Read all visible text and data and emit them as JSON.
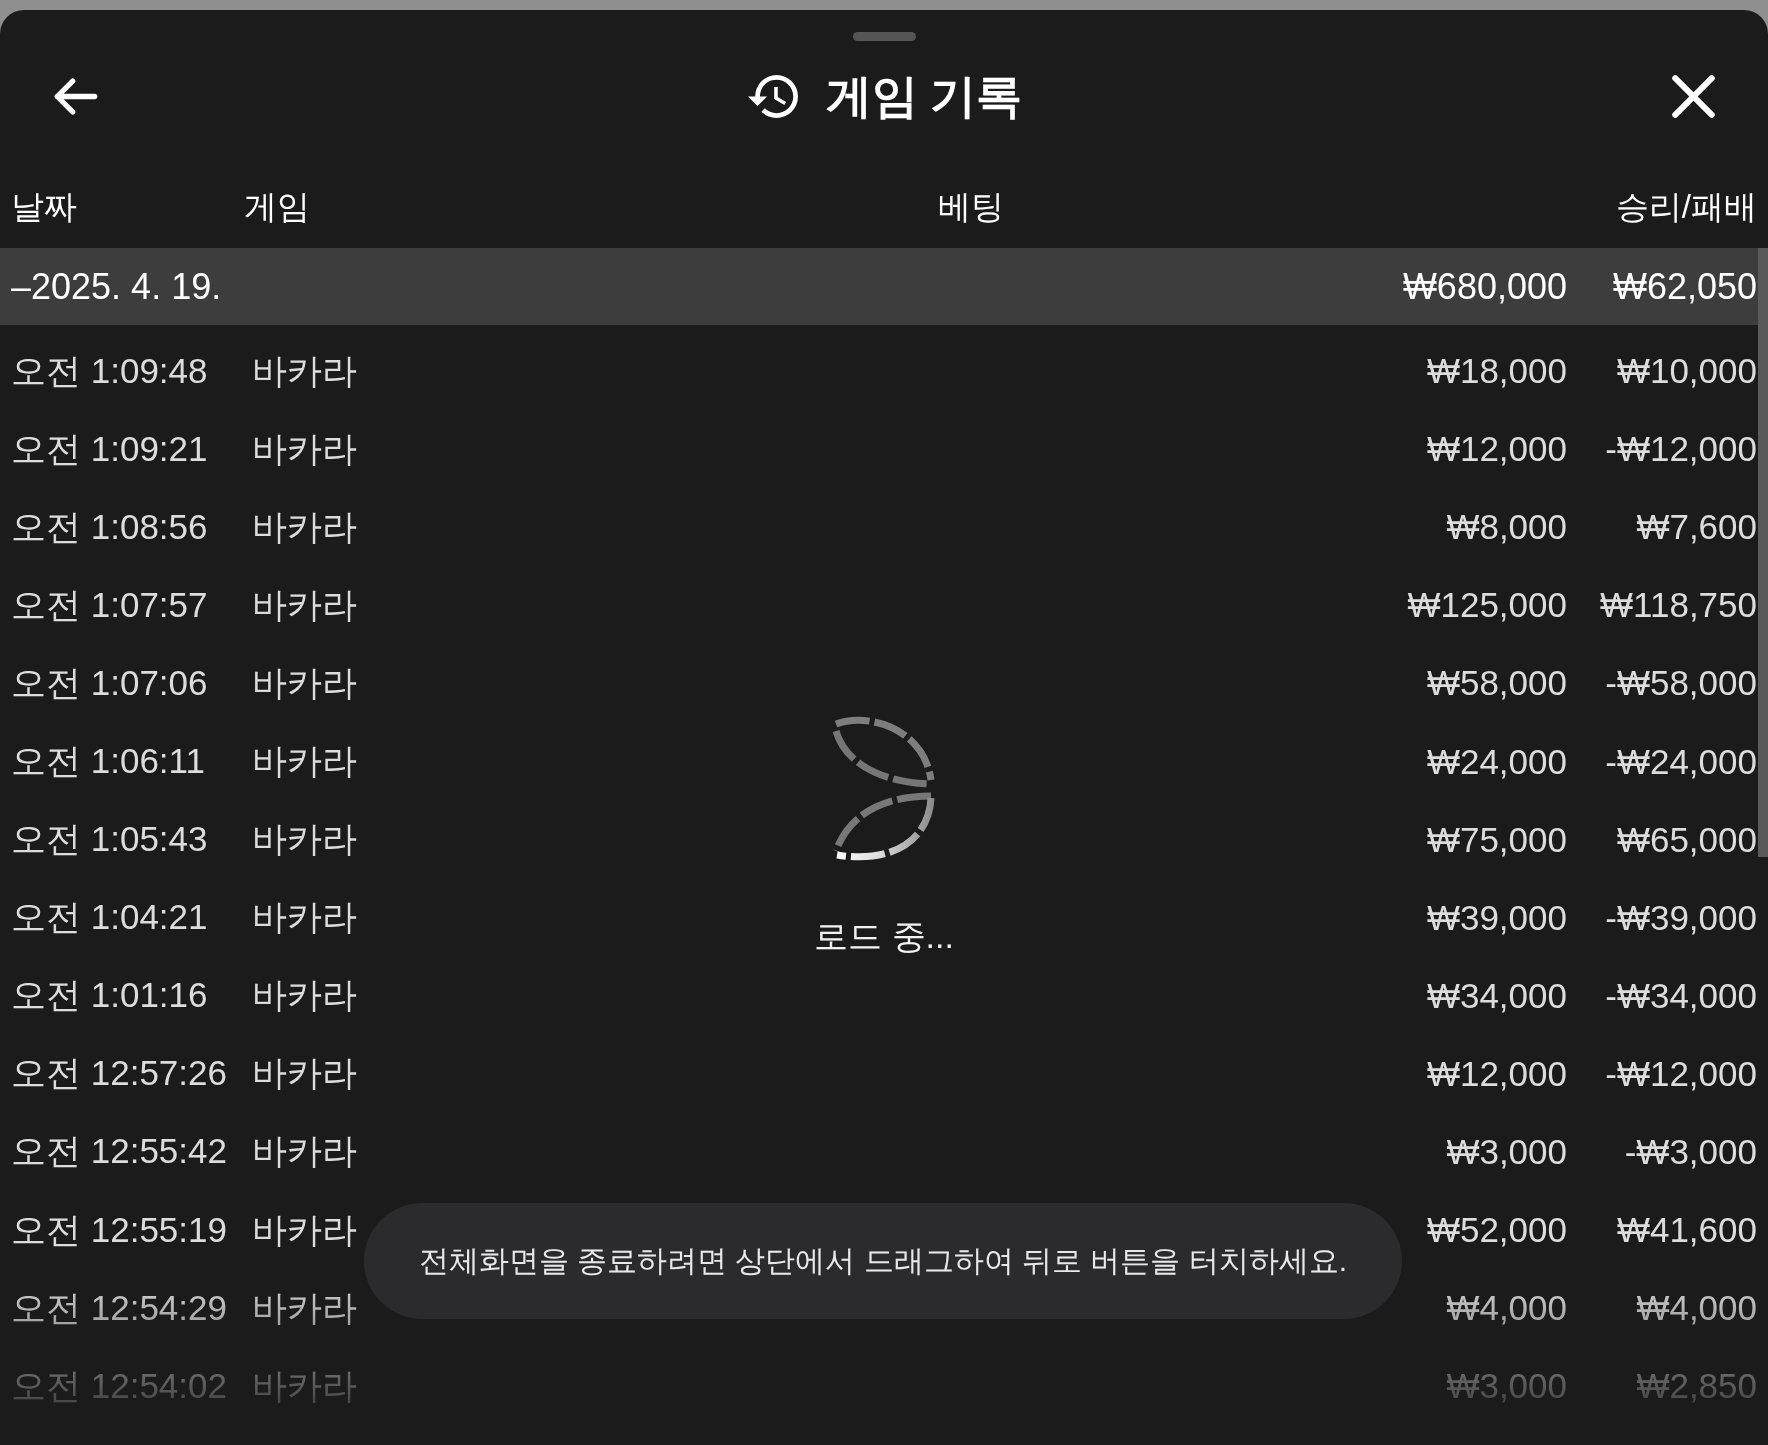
{
  "sheet": {
    "title": "게임 기록"
  },
  "table": {
    "columns": [
      "날짜",
      "게임",
      "베팅",
      "승리/패배"
    ],
    "groups": [
      {
        "toggle": "–",
        "date": "2025. 4. 19.",
        "expanded": true,
        "bet_total": "₩680,000",
        "result_total": "₩62,050",
        "rows": [
          {
            "time": "오전 1:09:48",
            "game": "바카라",
            "bet": "₩18,000",
            "result": "₩10,000"
          },
          {
            "time": "오전 1:09:21",
            "game": "바카라",
            "bet": "₩12,000",
            "result": "-₩12,000"
          },
          {
            "time": "오전 1:08:56",
            "game": "바카라",
            "bet": "₩8,000",
            "result": "₩7,600"
          },
          {
            "time": "오전 1:07:57",
            "game": "바카라",
            "bet": "₩125,000",
            "result": "₩118,750"
          },
          {
            "time": "오전 1:07:06",
            "game": "바카라",
            "bet": "₩58,000",
            "result": "-₩58,000"
          },
          {
            "time": "오전 1:06:11",
            "game": "바카라",
            "bet": "₩24,000",
            "result": "-₩24,000"
          },
          {
            "time": "오전 1:05:43",
            "game": "바카라",
            "bet": "₩75,000",
            "result": "₩65,000"
          },
          {
            "time": "오전 1:04:21",
            "game": "바카라",
            "bet": "₩39,000",
            "result": "-₩39,000"
          },
          {
            "time": "오전 1:01:16",
            "game": "바카라",
            "bet": "₩34,000",
            "result": "-₩34,000"
          },
          {
            "time": "오전 12:57:26",
            "game": "바카라",
            "bet": "₩12,000",
            "result": "-₩12,000"
          },
          {
            "time": "오전 12:55:42",
            "game": "바카라",
            "bet": "₩3,000",
            "result": "-₩3,000"
          },
          {
            "time": "오전 12:55:19",
            "game": "바카라",
            "bet": "₩52,000",
            "result": "₩41,600"
          },
          {
            "time": "오전 12:54:29",
            "game": "바카라",
            "bet": "₩4,000",
            "result": "₩4,000"
          },
          {
            "time": "오전 12:54:02",
            "game": "바카라",
            "bet": "₩3,000",
            "result": "₩2,850"
          }
        ]
      }
    ]
  },
  "loading": {
    "label": "로드 중..."
  },
  "toast": {
    "text": "전체화면을 종료하려면 상단에서 드래그하여 뒤로 버튼을 터치하세요."
  }
}
